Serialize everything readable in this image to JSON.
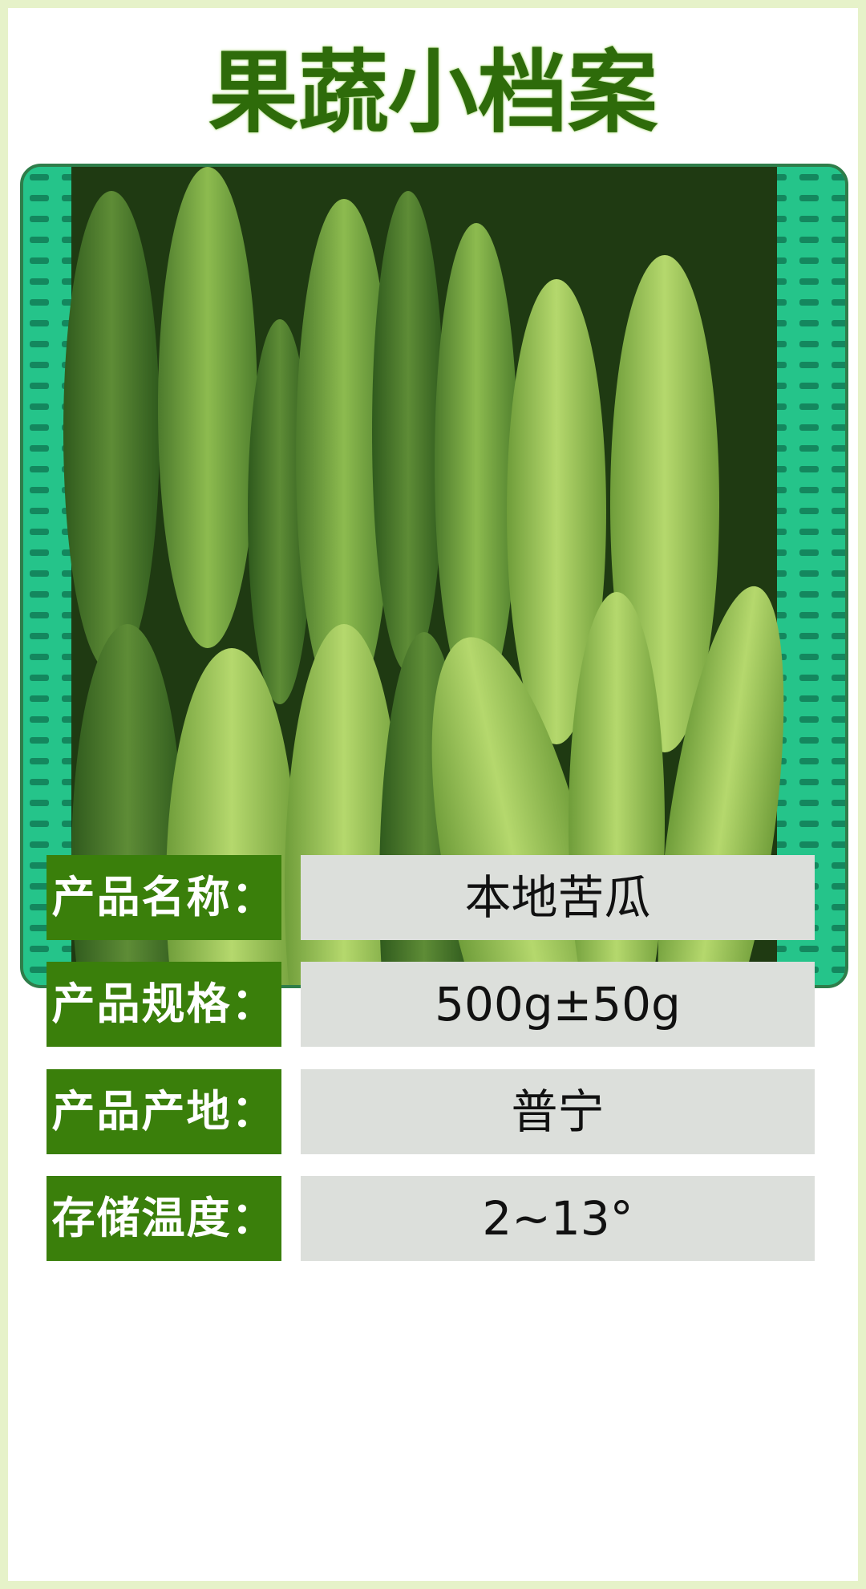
{
  "title": "果蔬小档案",
  "photo": {
    "subject": "bitter-melon-image"
  },
  "rows": [
    {
      "label": "产品名称：",
      "value": "本地苦瓜"
    },
    {
      "label": "产品规格：",
      "value": "500g±50g"
    },
    {
      "label": "产品产地：",
      "value": "普宁"
    },
    {
      "label": "存储温度：",
      "value": "2~13°"
    }
  ],
  "colors": {
    "background": "#e6f2c9",
    "title": "#2e6b0a",
    "label_bg": "#3a7f0b",
    "value_bg": "#dcdfdb",
    "frame": "#2f7d4a",
    "crate": "#25c48a"
  }
}
